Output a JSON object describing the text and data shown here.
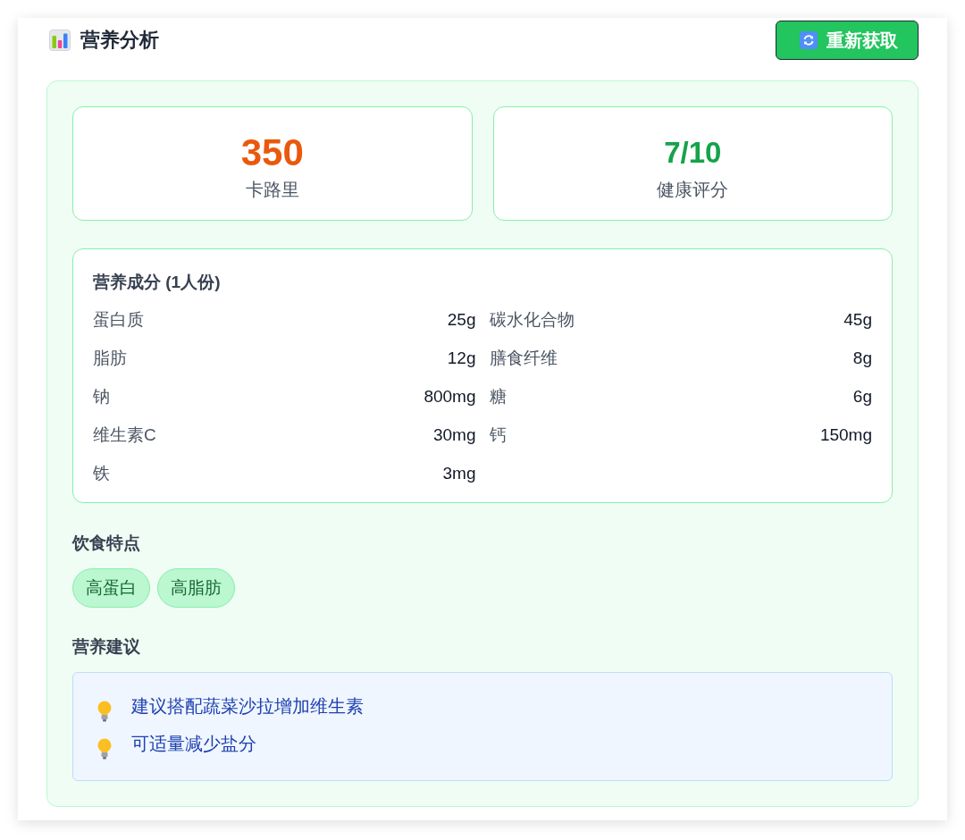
{
  "header": {
    "title": "营养分析",
    "refresh_button": {
      "label": "重新获取"
    }
  },
  "summary_cards": [
    {
      "kind": "calories",
      "value": "350",
      "label": "卡路里",
      "color": "#ea580c"
    },
    {
      "kind": "health_score",
      "value": "7/10",
      "label": "健康评分",
      "color": "#16a34a"
    }
  ],
  "nutrients": {
    "title": "营养成分 (1人份)",
    "items": [
      {
        "name": "蛋白质",
        "amount": "25g"
      },
      {
        "name": "碳水化合物",
        "amount": "45g"
      },
      {
        "name": "脂肪",
        "amount": "12g"
      },
      {
        "name": "膳食纤维",
        "amount": "8g"
      },
      {
        "name": "钠",
        "amount": "800mg"
      },
      {
        "name": "糖",
        "amount": "6g"
      },
      {
        "name": "维生素C",
        "amount": "30mg"
      },
      {
        "name": "钙",
        "amount": "150mg"
      },
      {
        "name": "铁",
        "amount": "3mg"
      }
    ]
  },
  "diet_features": {
    "title": "饮食特点",
    "tags": [
      "高蛋白",
      "高脂肪"
    ]
  },
  "advice": {
    "title": "营养建议",
    "items": [
      "建议搭配蔬菜沙拉增加维生素",
      "可适量减少盐分"
    ]
  }
}
